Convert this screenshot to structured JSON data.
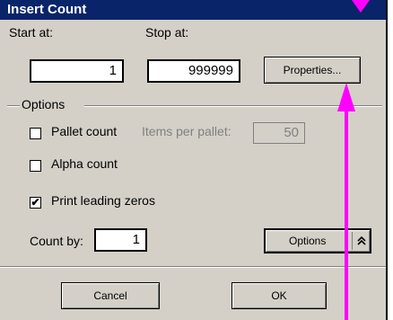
{
  "window": {
    "title": "Insert Count"
  },
  "start": {
    "label": "Start at:",
    "value": "1"
  },
  "stop": {
    "label": "Stop at:",
    "value": "999999"
  },
  "buttons": {
    "properties": "Properties...",
    "options": "Options",
    "cancel": "Cancel",
    "ok": "OK"
  },
  "options_group": {
    "label": "Options"
  },
  "pallet": {
    "label": "Pallet count",
    "checked": false,
    "items_label": "Items per pallet:",
    "items_value": "50"
  },
  "alpha": {
    "label": "Alpha count",
    "checked": false
  },
  "leading": {
    "label": "Print leading zeros",
    "checked": true,
    "mark": "✔"
  },
  "count_by": {
    "label": "Count by:",
    "value": "1"
  },
  "icons": {
    "collapse": "double-chevron-up-icon"
  },
  "colors": {
    "annotation": "#ff00ff",
    "titlebar": "#0a246a"
  }
}
